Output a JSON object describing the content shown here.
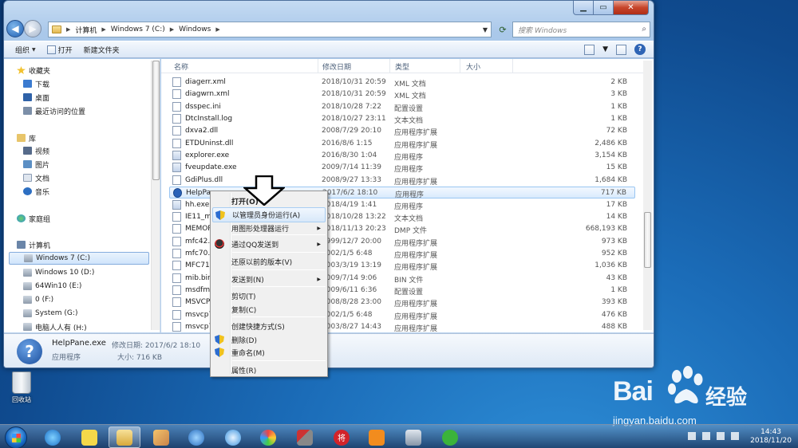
{
  "window": {
    "address": [
      "计算机",
      "Windows 7 (C:)",
      "Windows"
    ],
    "search_placeholder": "搜索 Windows",
    "commands": [
      "组织",
      "打开",
      "新建文件夹"
    ],
    "columns": [
      "名称",
      "修改日期",
      "类型",
      "大小"
    ]
  },
  "nav": {
    "favorites": "收藏夹",
    "fav_items": [
      "下载",
      "桌面",
      "最近访问的位置"
    ],
    "library": "库",
    "lib_items": [
      "视频",
      "图片",
      "文档",
      "音乐"
    ],
    "homegroup": "家庭组",
    "computer": "计算机",
    "drives": [
      "Windows 7 (C:)",
      "Windows 10 (D:)",
      "64Win10 (E:)",
      "0 (F:)",
      "System (G:)",
      "电脑人人有 (H:)"
    ]
  },
  "files": [
    {
      "name": "diagerr.xml",
      "date": "2018/10/31 20:59",
      "type": "XML 文档",
      "size": "2 KB"
    },
    {
      "name": "diagwrn.xml",
      "date": "2018/10/31 20:59",
      "type": "XML 文档",
      "size": "3 KB"
    },
    {
      "name": "dsspec.ini",
      "date": "2018/10/28 7:22",
      "type": "配置设置",
      "size": "1 KB"
    },
    {
      "name": "DtcInstall.log",
      "date": "2018/10/27 23:11",
      "type": "文本文档",
      "size": "1 KB"
    },
    {
      "name": "dxva2.dll",
      "date": "2008/7/29 20:10",
      "type": "应用程序扩展",
      "size": "72 KB"
    },
    {
      "name": "ETDUninst.dll",
      "date": "2016/8/6 1:15",
      "type": "应用程序扩展",
      "size": "2,486 KB"
    },
    {
      "name": "explorer.exe",
      "date": "2016/8/30 1:04",
      "type": "应用程序",
      "size": "3,154 KB"
    },
    {
      "name": "fveupdate.exe",
      "date": "2009/7/14 11:39",
      "type": "应用程序",
      "size": "15 KB"
    },
    {
      "name": "GdiPlus.dll",
      "date": "2008/9/27 13:33",
      "type": "应用程序扩展",
      "size": "1,684 KB"
    },
    {
      "name": "HelpPane.exe",
      "date": "2017/6/2 18:10",
      "type": "应用程序",
      "size": "717 KB"
    },
    {
      "name": "hh.exe",
      "date": "2018/4/19 1:41",
      "type": "应用程序",
      "size": "17 KB"
    },
    {
      "name": "IE11_main.log",
      "date": "2018/10/28 13:22",
      "type": "文本文档",
      "size": "14 KB"
    },
    {
      "name": "MEMORY.DMP",
      "date": "2018/11/13 20:23",
      "type": "DMP 文件",
      "size": "668,193 KB"
    },
    {
      "name": "mfc42.dll",
      "date": "1999/12/7 20:00",
      "type": "应用程序扩展",
      "size": "973 KB"
    },
    {
      "name": "mfc70.dll",
      "date": "2002/1/5 6:48",
      "type": "应用程序扩展",
      "size": "952 KB"
    },
    {
      "name": "MFC71.dll",
      "date": "2003/3/19 13:19",
      "type": "应用程序扩展",
      "size": "1,036 KB"
    },
    {
      "name": "mib.bin",
      "date": "2009/7/14 9:06",
      "type": "BIN 文件",
      "size": "43 KB"
    },
    {
      "name": "msdfmap.ini",
      "date": "2009/6/11 6:36",
      "type": "配置设置",
      "size": "1 KB"
    },
    {
      "name": "MSVCP60.dll",
      "date": "2008/8/28 23:00",
      "type": "应用程序扩展",
      "size": "393 KB"
    },
    {
      "name": "msvcp70.dll",
      "date": "2002/1/5 6:48",
      "type": "应用程序扩展",
      "size": "476 KB"
    },
    {
      "name": "msvcp71.dll",
      "date": "2003/8/27 14:43",
      "type": "应用程序扩展",
      "size": "488 KB"
    }
  ],
  "visible_names": [
    "diagerr.xml",
    "diagwrn.xml",
    "dsspec.ini",
    "DtcInstall.log",
    "dxva2.dll",
    "ETDUninst.dll",
    "explorer.exe",
    "fveupdate.exe",
    "GdiPlus.dll",
    "HelpPane",
    "hh.exe",
    "IE11_ma",
    "MEMOR",
    "mfc42.dl",
    "mfc70.dll",
    "MFC71.c",
    "mib.bin",
    "msdfma",
    "MSVCP6",
    "msvcp70",
    "msvcp71"
  ],
  "visible_dates": [
    "2018/10/31 20:59",
    "2018/10/31 20:59",
    "2018/10/28 7:22",
    "2018/10/27 23:11",
    "2008/7/29 20:10",
    "2016/8/6 1:15",
    "2016/8/30 1:04",
    "2009/7/14 11:39",
    "2008/9/27 13:33",
    "2017/6/2 18:10",
    "2018/4/19 1:41",
    "2018/10/28 13:22",
    "2018/11/13 20:23",
    "1999/12/7 20:00",
    "2002/1/5 6:48",
    "2003/3/19 13:19",
    "2009/7/14 9:06",
    "2009/6/11 6:36",
    "2008/8/28 23:00",
    "2002/1/5 6:48",
    "2003/8/27 14:43"
  ],
  "context_menu": [
    {
      "label": "打开(O)",
      "bold": true
    },
    {
      "label": "以管理员身份运行(A)",
      "icon": "shield-icon",
      "highlight": true
    },
    {
      "label": "用图形处理器运行",
      "submenu": true
    },
    {
      "label": "通过QQ发送到",
      "icon": "qq-icon",
      "submenu": true
    },
    {
      "label": "还原以前的版本(V)"
    },
    {
      "label": "发送到(N)",
      "submenu": true
    },
    {
      "label": "剪切(T)"
    },
    {
      "label": "复制(C)"
    },
    {
      "label": "创建快捷方式(S)"
    },
    {
      "label": "删除(D)",
      "icon": "shield-icon"
    },
    {
      "label": "重命名(M)",
      "icon": "shield-icon"
    },
    {
      "label": "属性(R)"
    }
  ],
  "details": {
    "name": "HelpPane.exe",
    "modified_label": "修改日期: 2017/6/2 18:10",
    "type": "应用程序",
    "size_label": "大小: 716 KB"
  },
  "desktop": {
    "recycle_bin": "回收站"
  },
  "watermark": {
    "logo": "Bai",
    "logo2": "du",
    "cn": "经验",
    "url": "jingyan.baidu.com"
  },
  "clock": {
    "time": "14:43",
    "date": "2018/11/20"
  },
  "colors": {
    "selection": "#cfe4fb",
    "window_frame": "#aac8ea",
    "taskbar": "#1e3c64"
  }
}
